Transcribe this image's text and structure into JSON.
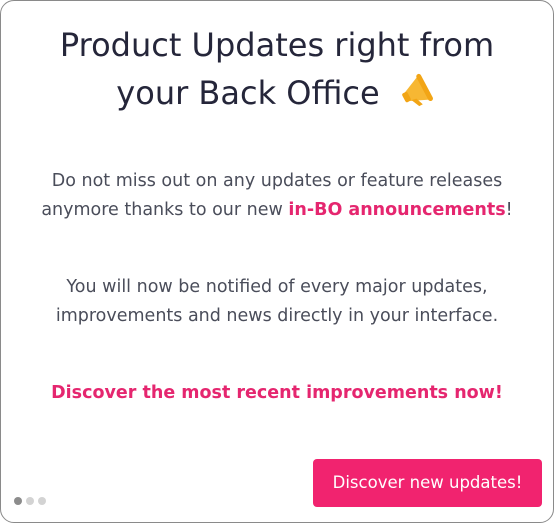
{
  "title": {
    "line1": "Product Updates right from",
    "line2": "your Back Office"
  },
  "title_icon": "megaphone-icon",
  "intro": {
    "before": "Do not miss out on any updates or feature releases anymore thanks to our new ",
    "link": "in-BO announcements",
    "after": "!"
  },
  "notice": "You will now be notified of every major updates, improvements and news directly in your interface.",
  "cta_text": "Discover the most recent improvements now!",
  "button_label": "Discover new updates!",
  "pagination": {
    "total": 3,
    "current": 1
  },
  "colors": {
    "accent": "#f1236f",
    "highlight": "#e5266f",
    "icon": "#f7b733"
  }
}
